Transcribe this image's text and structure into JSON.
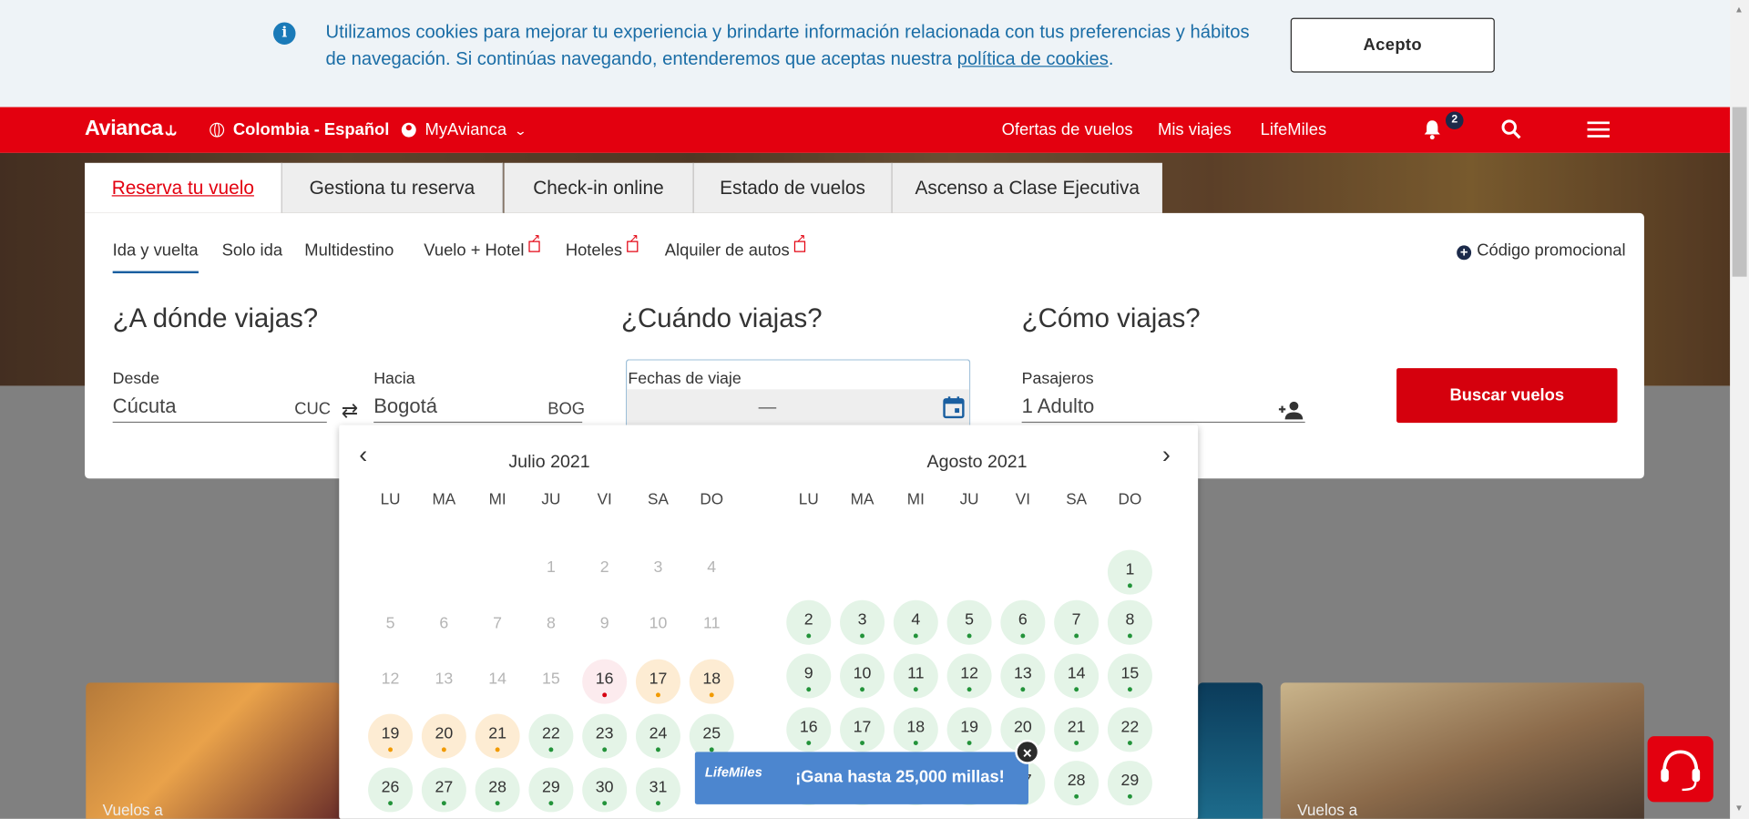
{
  "cookie": {
    "text": "Utilizamos cookies para mejorar tu experiencia y brindarte información relacionada con tus preferencias y hábitos de navegación. Si continúas navegando, entenderemos que aceptas nuestra",
    "link": "política de cookies",
    "end": ".",
    "accept_label": "Acepto"
  },
  "nav": {
    "brand": "Avianca",
    "region": "Colombia - Español",
    "account": "MyAvianca",
    "links": [
      "Ofertas de vuelos",
      "Mis viajes",
      "LifeMiles"
    ],
    "notifications_count": "2"
  },
  "tabs": [
    "Reserva tu vuelo",
    "Gestiona tu reserva",
    "Check-in online",
    "Estado de vuelos",
    "Ascenso a Clase Ejecutiva"
  ],
  "subtabs": [
    "Ida y vuelta",
    "Solo ida",
    "Multidestino",
    "Vuelo + Hotel",
    "Hoteles",
    "Alquiler de autos"
  ],
  "promo": "Código promocional",
  "where": {
    "title": "¿A dónde viajas?",
    "from_label": "Desde",
    "from_value": "Cúcuta",
    "from_code": "CUC",
    "to_label": "Hacia",
    "to_value": "Bogotá",
    "to_code": "BOG"
  },
  "when": {
    "title": "¿Cuándo viajas?",
    "dates_label": "Fechas de viaje",
    "dash": "—"
  },
  "how": {
    "title": "¿Cómo viajas?",
    "pax_label": "Pasajeros",
    "pax_value": "1 Adulto"
  },
  "search_button": "Buscar vuelos",
  "calendar": {
    "weekdays": [
      "LU",
      "MA",
      "MI",
      "JU",
      "VI",
      "SA",
      "DO"
    ],
    "months": [
      {
        "title": "Julio 2021",
        "first_weekday": 3,
        "days": 31,
        "status": {
          "16": "r",
          "17": "o",
          "18": "o",
          "19": "o",
          "20": "o",
          "21": "o",
          "22": "g",
          "23": "g",
          "24": "g",
          "25": "g",
          "26": "g",
          "27": "g",
          "28": "g",
          "29": "g",
          "30": "g",
          "31": "g"
        },
        "disabled_until": 15
      },
      {
        "title": "Agosto 2021",
        "first_weekday": 6,
        "days": 29,
        "status": "all-g",
        "disabled_until": 0
      }
    ]
  },
  "lifemiles": {
    "logo": "LifeMiles",
    "message": "¡Gana hasta 25,000 millas!"
  },
  "cards": [
    "Vuelos a",
    "Vuelos a"
  ]
}
